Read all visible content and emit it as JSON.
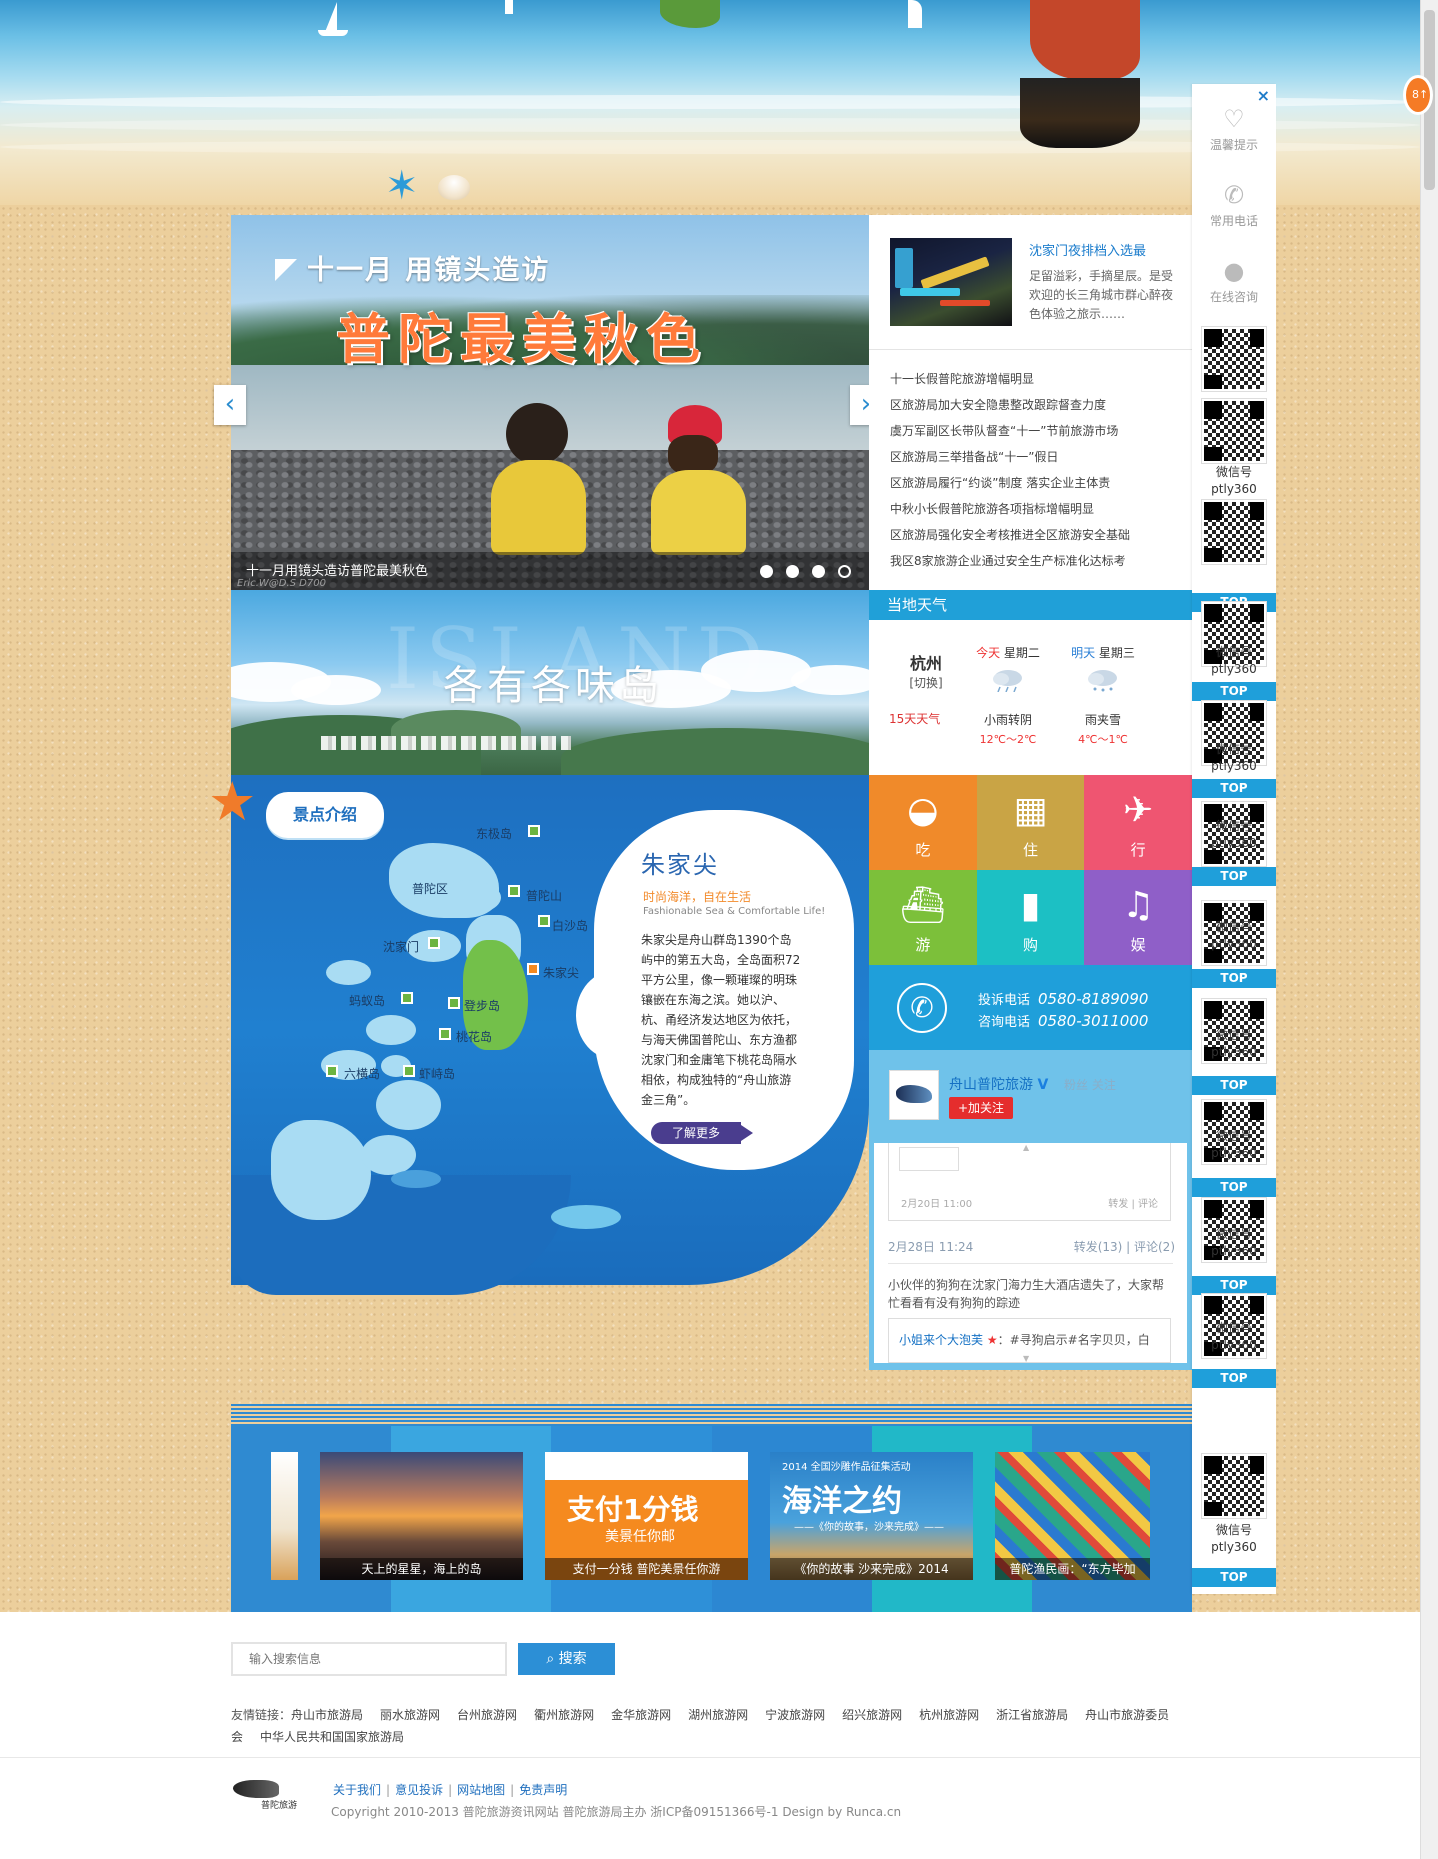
{
  "slider": {
    "heading": "十一月 用镜头造访",
    "title": "普陀最美秋色",
    "caption": "十一月用镜头造访普陀最美秋色",
    "credit": "Eric.W@D.S D700",
    "prev": "‹",
    "next": "›",
    "dots": 4,
    "active_dot": 4
  },
  "news": {
    "top_title": "沈家门夜排档入选最",
    "top_desc": "足留溢彩，手摘星辰。是受欢迎的长三角城市群心醉夜色体验之旅示……",
    "items": [
      "十一长假普陀旅游增幅明显",
      "区旅游局加大安全隐患整改跟踪督查力度",
      "虞万军副区长带队督查“十一”节前旅游市场",
      "区旅游局三举措备战“十一”假日",
      "区旅游局履行“约谈”制度 落实企业主体责",
      "中秋小长假普陀旅游各项指标增幅明显",
      "区旅游局强化安全考核推进全区旅游安全基础",
      "我区8家旅游企业通过安全生产标准化达标考"
    ]
  },
  "island": {
    "ghost": "ISLAND",
    "title": "各有各味岛"
  },
  "weather": {
    "bar_title": "当地天气",
    "city": "杭州",
    "switch": "[切换]",
    "fifteen": "15天天气",
    "days": [
      {
        "tag": "今天",
        "week": "星期二",
        "cond": "小雨转阴",
        "temp": "12℃～2℃"
      },
      {
        "tag": "明天",
        "week": "星期三",
        "cond": "雨夹雪",
        "temp": "4℃～1℃"
      }
    ]
  },
  "map": {
    "tag": "景点介绍",
    "places": [
      "东极岛",
      "普陀区",
      "普陀山",
      "白沙岛",
      "沈家门",
      "朱家尖",
      "蚂蚁岛",
      "登步岛",
      "桃花岛",
      "六横岛",
      "虾峙岛"
    ],
    "spot_title": "朱家尖",
    "spot_slogan": "时尚海洋，自在生活",
    "spot_en": "Fashionable Sea & Comfortable Life!",
    "spot_desc": "朱家尖是舟山群岛1390个岛屿中的第五大岛，全岛面积72平方公里，像一颗璀璨的明珠镶嵌在东海之滨。她以沪、杭、甬经济发达地区为依托，与海天佛国普陀山、东方渔都沈家门和金庸笔下桃花岛隔水相依，构成独特的“舟山旅游金三角”。",
    "more": "了解更多"
  },
  "tiles": [
    {
      "label": "吃",
      "icon": "bowl-icon",
      "color": "#f08a2a"
    },
    {
      "label": "住",
      "icon": "building-icon",
      "color": "#c9a445"
    },
    {
      "label": "行",
      "icon": "plane-icon",
      "color": "#ef5571"
    },
    {
      "label": "游",
      "icon": "ship-icon",
      "color": "#7cc03a"
    },
    {
      "label": "购",
      "icon": "bag-icon",
      "color": "#1cc0c4"
    },
    {
      "label": "娱",
      "icon": "headphone-icon",
      "color": "#8f5fc8"
    }
  ],
  "contact": {
    "complain_label": "投诉电话",
    "complain_number": "0580-8189090",
    "consult_label": "咨询电话",
    "consult_number": "0580-3011000"
  },
  "weibo": {
    "name": "舟山普陀旅游",
    "verified": "V",
    "fans": "粉丝 关注",
    "follow": "+加关注",
    "inner_meta_left": "2月20日 11:00",
    "inner_meta_right": "转发 | 评论",
    "date": "2月28日 11:24",
    "repost": "转发(13)",
    "comment": "评论(2)",
    "post": "小伙伴的狗狗在沈家门海力生大酒店遗失了，大家帮忙看看有没有狗狗的踪迹",
    "quote_user": "小姐来个大泡芙",
    "quote_text": "：#寻狗启示#名字贝贝，白"
  },
  "gallery": {
    "stripe_colors": [
      "#2f8ad1",
      "#3aa6e0",
      "#2e90d8",
      "#2c87d2",
      "#21b8c8",
      "#2f8ad1"
    ],
    "cards": [
      {
        "caption": "天上的星星，海上的岛"
      },
      {
        "caption": "支付一分钱 普陀美景任你游"
      },
      {
        "caption": "《你的故事 沙来完成》2014"
      },
      {
        "caption": "普陀渔民画：“东方毕加"
      }
    ],
    "card2_text": "支付1分钱",
    "card2_sub": "美景任你邮",
    "card3_text": "海洋之约",
    "card3_top": "2014 全国沙雕作品征集活动",
    "card3_sub": "——《你的故事，沙来完成》——"
  },
  "side": {
    "close": "×",
    "items": [
      {
        "label": "温馨提示",
        "icon": "heart-icon"
      },
      {
        "label": "常用电话",
        "icon": "phone-icon"
      },
      {
        "label": "在线咨询",
        "icon": "chat-icon"
      }
    ],
    "wx_label": "微信号",
    "wx_id": "ptly360",
    "top_label": "TOP",
    "badge": "8↑"
  },
  "search": {
    "placeholder": "输入搜索信息",
    "button": "搜索"
  },
  "friend_links": {
    "label": "友情链接：",
    "items": [
      "舟山市旅游局",
      "丽水旅游网",
      "台州旅游网",
      "衢州旅游网",
      "金华旅游网",
      "湖州旅游网",
      "宁波旅游网",
      "绍兴旅游网",
      "杭州旅游网",
      "浙江省旅游局",
      "舟山市旅游委员会",
      "中华人民共和国国家旅游局"
    ]
  },
  "footer": {
    "logo_text": "普陀旅游",
    "links": [
      "关于我们",
      "意见投诉",
      "网站地图",
      "免责声明"
    ],
    "copyright": "Copyright 2010-2013  普陀旅游资讯网站   普陀旅游局主办   浙ICP备09151366号-1  Design by Runca.cn"
  }
}
